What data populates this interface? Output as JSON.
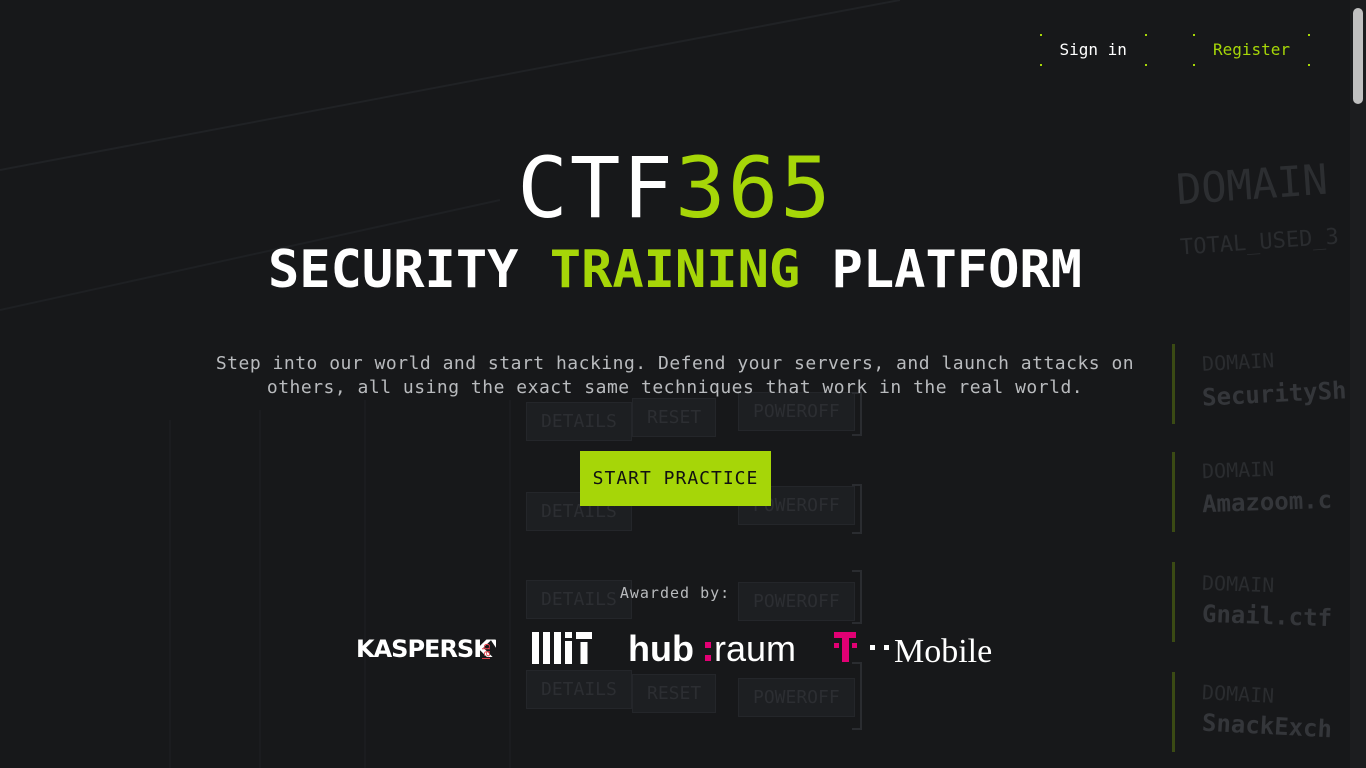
{
  "nav": {
    "signin_label": "Sign in",
    "register_label": "Register"
  },
  "hero": {
    "logo_prefix": "CTF",
    "logo_suffix": "365",
    "tagline_part1": "SECURITY",
    "tagline_part2": "TRAINING",
    "tagline_part3": "PLATFORM",
    "description_line1": "Step into our world and start hacking. Defend your servers, and launch attacks on",
    "description_line2": "others, all using the exact same techniques that work in the real world."
  },
  "cta": {
    "label": "START PRACTICE"
  },
  "awards": {
    "heading": "Awarded by:",
    "logos": [
      "kaspersky-lab-logo",
      "mit-logo",
      "hubraum-logo",
      "t-mobile-logo"
    ],
    "kaspersky_text": "KASPERSKY",
    "kaspersky_sub": "lab",
    "hubraum_text1": "hub",
    "hubraum_text2": "raum",
    "tmobile_text": "Mobile"
  },
  "background": {
    "domain_title": "DOMAIN",
    "total_used": "TOTAL_USED_3",
    "domain_label": "DOMAIN",
    "domains": [
      "SecuritySh",
      "Amazoom.c",
      "Gnail.ctf",
      "SnackExch"
    ],
    "buttons": [
      "DETAILS",
      "RESET",
      "POWEROFF"
    ]
  },
  "colors": {
    "accent": "#a6d608",
    "background": "#17181a",
    "magenta": "#e20074"
  }
}
